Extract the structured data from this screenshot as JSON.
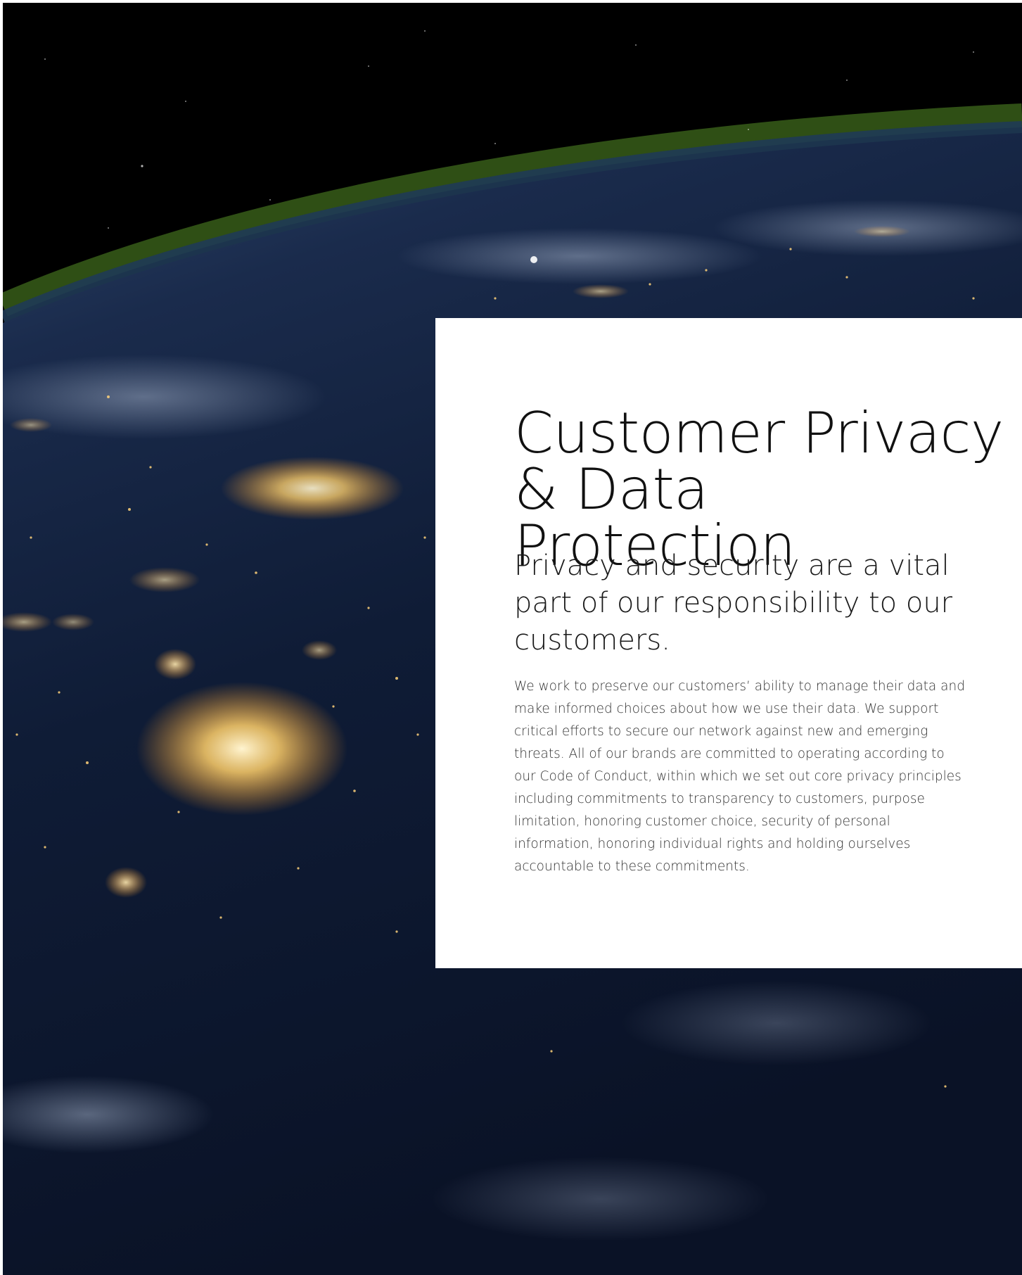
{
  "background_image": {
    "subject": "earth-at-night-from-space",
    "colors": {
      "space": "#000000",
      "atmosphere": "#3a5a1e",
      "ocean": "#0d1a33",
      "city_lights": "#ffd27a"
    }
  },
  "panel": {
    "headline": "Customer Privacy\n& Data Protection",
    "subheading": "Privacy and security are a vital part of our responsibility to our customers.",
    "body": "We work to preserve our customers’ ability to manage their data and make informed choices about how we use their data. We support critical efforts to secure our network against new and emerging threats. All of our brands are committed to operating according to our Code of Conduct, within which we set out core privacy principles including commitments to transparency to customers, purpose limitation, honoring customer choice, security of personal information, honoring individual rights and holding ourselves accountable to these commitments."
  }
}
